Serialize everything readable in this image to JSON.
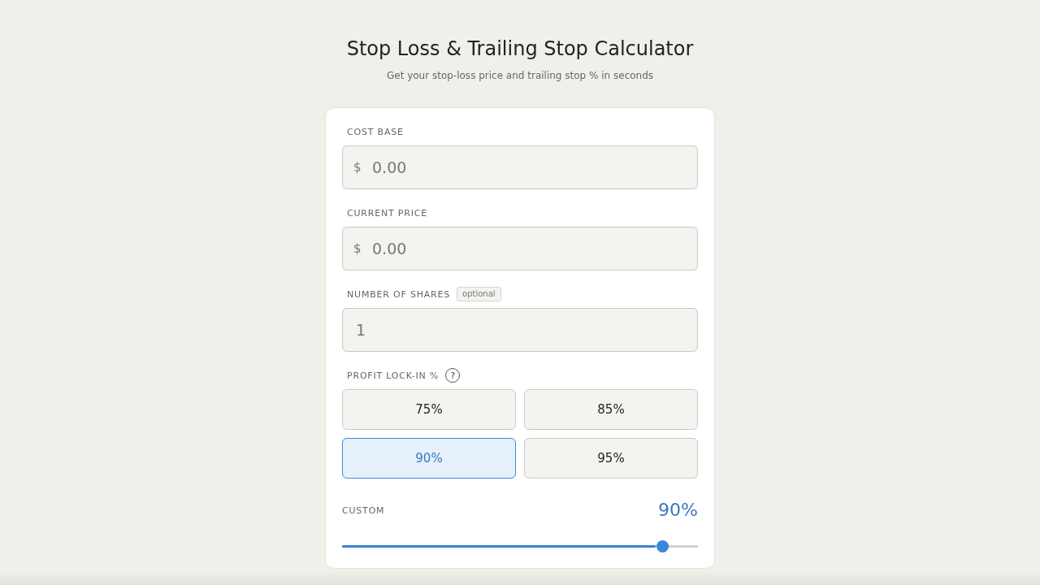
{
  "header": {
    "title": "Stop Loss & Trailing Stop Calculator",
    "subtitle": "Get your stop-loss price and trailing stop % in seconds"
  },
  "fields": [
    {
      "label": "COST BASE",
      "prefix": "$",
      "placeholder": "0.00"
    },
    {
      "label": "CURRENT PRICE",
      "prefix": "$",
      "placeholder": "0.00"
    },
    {
      "label": "NUMBER OF SHARES",
      "tag": "optional",
      "placeholder": "1"
    }
  ],
  "profit_lock_in": {
    "label": "PROFIT LOCK-IN %",
    "help": "?",
    "options": [
      {
        "label": "75%",
        "selected": false
      },
      {
        "label": "85%",
        "selected": false
      },
      {
        "label": "90%",
        "selected": true
      },
      {
        "label": "95%",
        "selected": false
      }
    ]
  },
  "custom": {
    "label": "CUSTOM",
    "reading": "90%",
    "level": 0.9
  }
}
